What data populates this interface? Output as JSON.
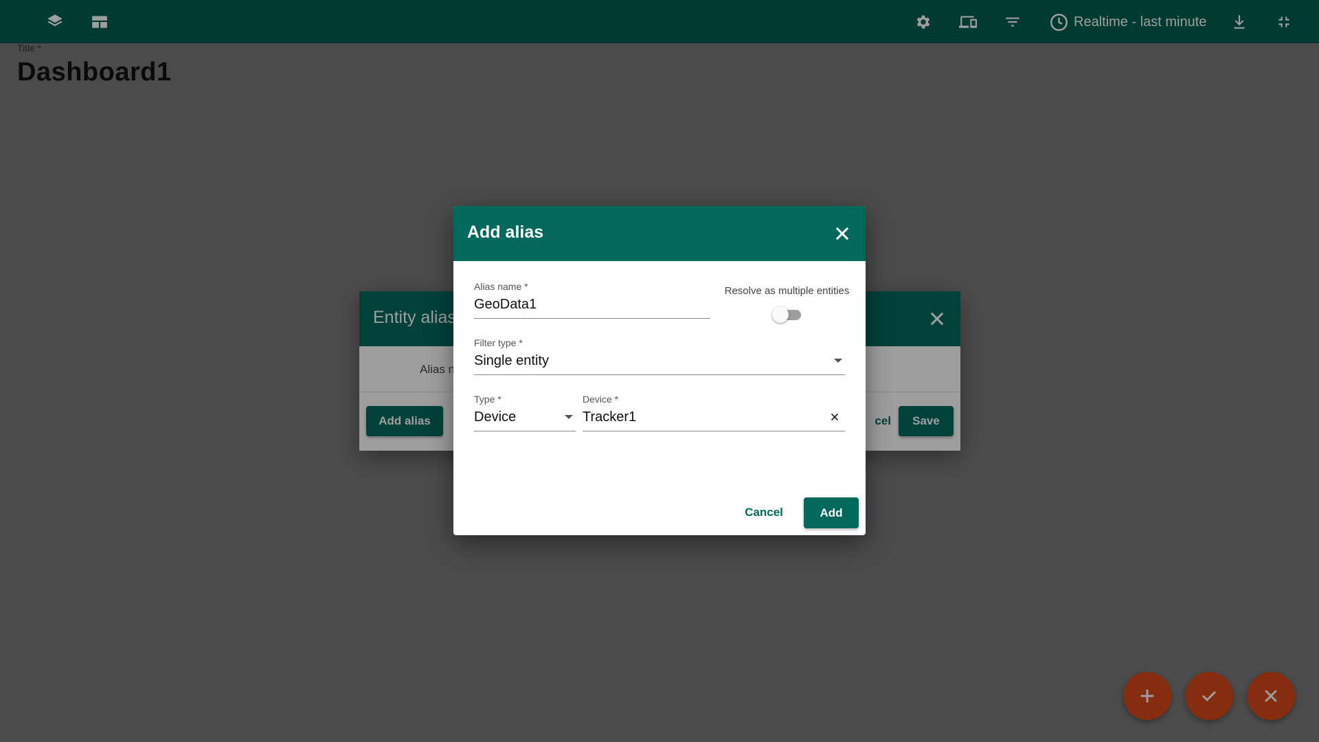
{
  "topbar": {
    "icons": [
      "layers-icon",
      "dashboard-layout-icon",
      "settings-icon",
      "devices-icon",
      "filter-icon",
      "clock-icon",
      "download-icon",
      "exit-fullscreen-icon"
    ],
    "timewindow_label": "Realtime - last minute",
    "bg_color": "#005e50"
  },
  "dashboard": {
    "title_label": "Title *",
    "title_value": "Dashboard1"
  },
  "entity_aliases_dialog": {
    "title": "Entity alias",
    "column_header": "Alias n",
    "add_alias_label": "Add alias",
    "cancel_label": "cel",
    "save_label": "Save"
  },
  "add_alias_dialog": {
    "title": "Add alias",
    "alias_name": {
      "label": "Alias name *",
      "value": "GeoData1"
    },
    "resolve_multiple": {
      "label": "Resolve as multiple entities",
      "checked": false
    },
    "filter_type": {
      "label": "Filter type *",
      "value": "Single entity"
    },
    "entity_type": {
      "label": "Type *",
      "value": "Device"
    },
    "device": {
      "label": "Device *",
      "value": "Tracker1"
    },
    "cancel_label": "Cancel",
    "add_label": "Add",
    "accent_color": "#00695c"
  },
  "fabs": [
    "add-icon",
    "check-icon",
    "close-icon"
  ],
  "fab_color": "#d9491b"
}
